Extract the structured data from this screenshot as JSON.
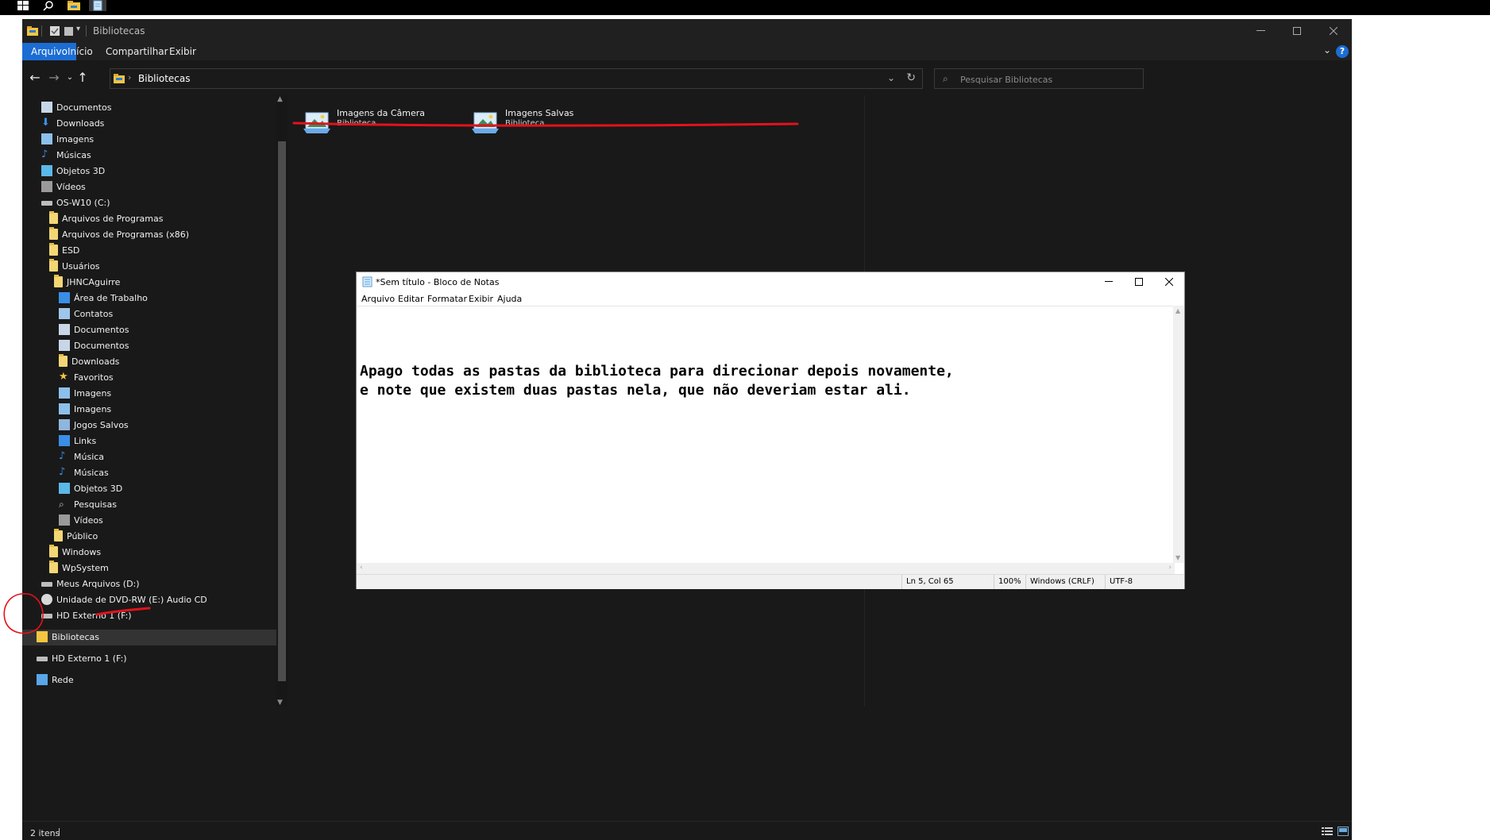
{
  "explorer": {
    "title": "Bibliotecas",
    "ribbon_tabs": [
      {
        "label": "Arquivo",
        "active": true
      },
      {
        "label": "Início"
      },
      {
        "label": "Compartilhar"
      },
      {
        "label": "Exibir"
      }
    ],
    "address": {
      "crumb": "Bibliotecas"
    },
    "search": {
      "placeholder": "Pesquisar Bibliotecas"
    },
    "nav_items": [
      {
        "label": "Documentos",
        "icon": "document-icon"
      },
      {
        "label": "Downloads",
        "icon": "download-icon"
      },
      {
        "label": "Imagens",
        "icon": "pictures-icon"
      },
      {
        "label": "Músicas",
        "icon": "music-icon"
      },
      {
        "label": "Objetos 3D",
        "icon": "objects3d-icon"
      },
      {
        "label": "Vídeos",
        "icon": "video-icon"
      },
      {
        "label": "OS-W10 (C:)",
        "icon": "drive-icon"
      },
      {
        "label": "Arquivos de Programas",
        "icon": "folder-icon"
      },
      {
        "label": "Arquivos de Programas (x86)",
        "icon": "folder-icon"
      },
      {
        "label": "ESD",
        "icon": "folder-icon"
      },
      {
        "label": "Usuários",
        "icon": "folder-icon"
      },
      {
        "label": "JHNCAguirre",
        "icon": "folder-icon"
      },
      {
        "label": "Área de Trabalho",
        "icon": "desktop-icon"
      },
      {
        "label": "Contatos",
        "icon": "contacts-icon"
      },
      {
        "label": "Documentos",
        "icon": "document-icon"
      },
      {
        "label": "Documentos",
        "icon": "document-icon"
      },
      {
        "label": "Downloads",
        "icon": "folder-icon"
      },
      {
        "label": "Favoritos",
        "icon": "star-icon"
      },
      {
        "label": "Imagens",
        "icon": "pictures-icon"
      },
      {
        "label": "Imagens",
        "icon": "pictures-icon"
      },
      {
        "label": "Jogos Salvos",
        "icon": "games-icon"
      },
      {
        "label": "Links",
        "icon": "links-icon"
      },
      {
        "label": "Música",
        "icon": "music-icon"
      },
      {
        "label": "Músicas",
        "icon": "music-icon"
      },
      {
        "label": "Objetos 3D",
        "icon": "objects3d-icon"
      },
      {
        "label": "Pesquisas",
        "icon": "search-icon"
      },
      {
        "label": "Vídeos",
        "icon": "video-icon"
      },
      {
        "label": "Público",
        "icon": "folder-icon"
      },
      {
        "label": "Windows",
        "icon": "folder-icon"
      },
      {
        "label": "WpSystem",
        "icon": "folder-icon"
      },
      {
        "label": "Meus Arquivos (D:)",
        "icon": "drive-icon"
      },
      {
        "label": "Unidade de DVD-RW (E:) Audio CD",
        "icon": "dvd-icon"
      },
      {
        "label": "HD Externo 1 (F:)",
        "icon": "drive-icon"
      },
      {
        "label": "Bibliotecas",
        "icon": "libraries-icon",
        "selected": true
      },
      {
        "label": "HD Externo 1 (F:)",
        "icon": "drive-icon"
      },
      {
        "label": "Rede",
        "icon": "network-icon"
      }
    ],
    "libraries": [
      {
        "name": "Imagens da Câmera",
        "type": "Biblioteca"
      },
      {
        "name": "Imagens Salvas",
        "type": "Biblioteca"
      }
    ],
    "status": {
      "item_count": "2 itens"
    }
  },
  "notepad": {
    "title": "*Sem título - Bloco de Notas",
    "menu": [
      "Arquivo",
      "Editar",
      "Formatar",
      "Exibir",
      "Ajuda"
    ],
    "text": "Apago todas as pastas da biblioteca para direcionar depois novamente,\ne note que existem duas pastas nela, que não deveriam estar ali.",
    "status": {
      "position": "Ln 5, Col 65",
      "zoom": "100%",
      "line_ending": "Windows (CRLF)",
      "encoding": "UTF-8"
    }
  },
  "colors": {
    "explorer_bg": "#191919",
    "accent": "#1b6dd4",
    "annotation": "#e3121b",
    "folder": "#f4d774"
  }
}
